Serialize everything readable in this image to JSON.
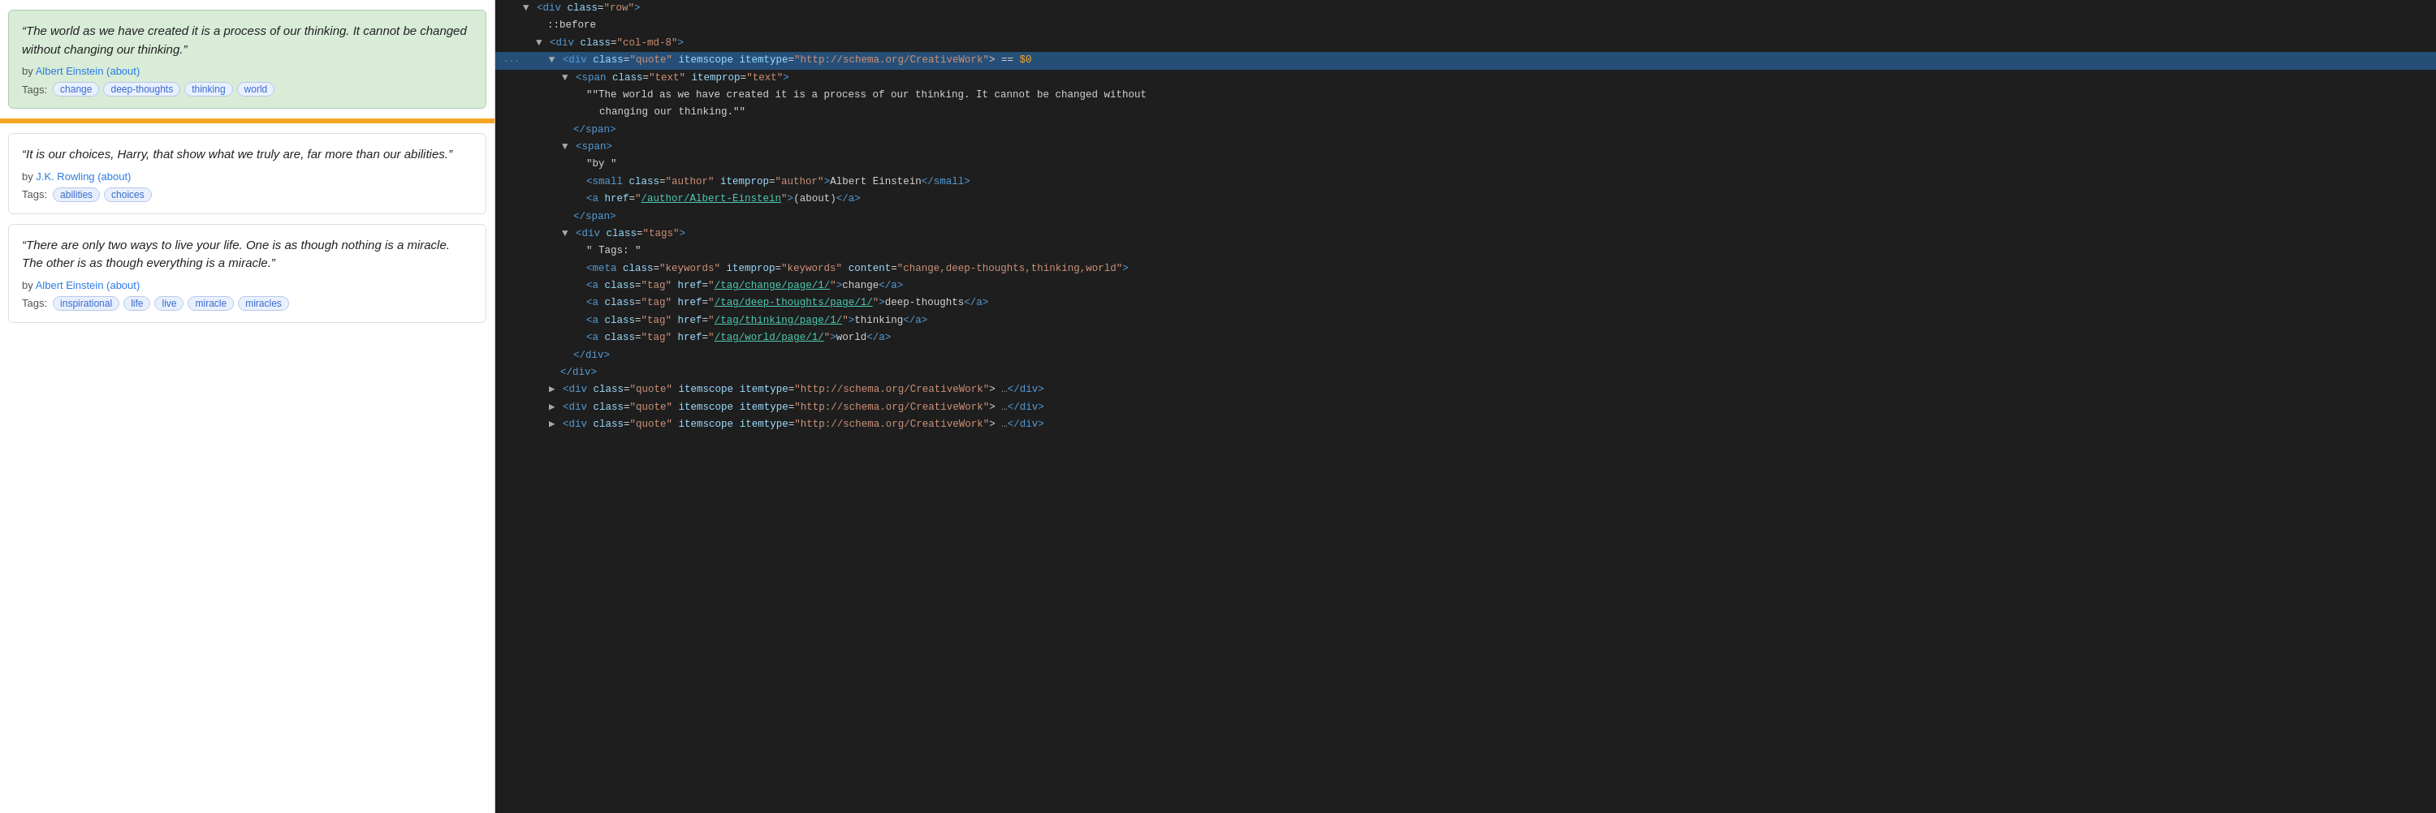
{
  "leftPanel": {
    "quotes": [
      {
        "id": "q1",
        "highlighted": true,
        "text": "“The world as we have created it is a process of our thinking. It cannot be changed without changing our thinking.”",
        "authorName": "Albert Einstein",
        "authorLink": "/author/Albert-Einstein",
        "aboutLink": "/author/Albert-Einstein/about",
        "tags": [
          "change",
          "deep-thoughts",
          "thinking",
          "world"
        ]
      },
      {
        "id": "q2",
        "highlighted": false,
        "text": "“It is our choices, Harry, that show what we truly are, far more than our abilities.”",
        "authorName": "J.K. Rowling",
        "authorLink": "/author/J-K-Rowling",
        "aboutLink": "/author/J-K-Rowling/about",
        "tags": [
          "abilities",
          "choices"
        ]
      },
      {
        "id": "q3",
        "highlighted": false,
        "text": "“There are only two ways to live your life. One is as though nothing is a miracle. The other is as though everything is a miracle.”",
        "authorName": "Albert Einstein",
        "authorLink": "/author/Albert-Einstein",
        "aboutLink": "/author/Albert-Einstein/about",
        "tags": [
          "inspirational",
          "life",
          "live",
          "miracle",
          "miracles"
        ]
      }
    ]
  },
  "rightPanel": {
    "lines": [
      {
        "indent": 0,
        "triangle": "down",
        "content": [
          {
            "t": "c-tag",
            "v": "<div "
          },
          {
            "t": "c-attr",
            "v": "class"
          },
          {
            "t": "c-equals",
            "v": "="
          },
          {
            "t": "c-string",
            "v": "\"row\""
          },
          {
            "t": "c-tag",
            "v": ">"
          }
        ]
      },
      {
        "indent": 1,
        "triangle": null,
        "content": [
          {
            "t": "c-text",
            "v": "::before"
          }
        ]
      },
      {
        "indent": 1,
        "triangle": "down",
        "content": [
          {
            "t": "c-tag",
            "v": "<div "
          },
          {
            "t": "c-attr",
            "v": "class"
          },
          {
            "t": "c-equals",
            "v": "="
          },
          {
            "t": "c-string",
            "v": "\"col-md-8\""
          },
          {
            "t": "c-tag",
            "v": ">"
          }
        ]
      },
      {
        "indent": 2,
        "triangle": "down",
        "content": [
          {
            "t": "c-tag",
            "v": "<div "
          },
          {
            "t": "c-attr",
            "v": "class"
          },
          {
            "t": "c-equals",
            "v": "="
          },
          {
            "t": "c-string",
            "v": "\"quote\""
          },
          {
            "t": "c-text",
            "v": " "
          },
          {
            "t": "c-attr",
            "v": "itemscope"
          },
          {
            "t": "c-text",
            "v": " "
          },
          {
            "t": "c-attr",
            "v": "itemtype"
          },
          {
            "t": "c-equals",
            "v": "="
          },
          {
            "t": "c-string",
            "v": "\"http://schema.org/CreativeWork\""
          },
          {
            "t": "c-text",
            "v": "> == "
          },
          {
            "t": "c-orange",
            "v": "$0"
          }
        ],
        "selected": true,
        "hasDots": true
      },
      {
        "indent": 3,
        "triangle": "down",
        "content": [
          {
            "t": "c-tag",
            "v": "<span "
          },
          {
            "t": "c-attr",
            "v": "class"
          },
          {
            "t": "c-equals",
            "v": "="
          },
          {
            "t": "c-string",
            "v": "\"text\""
          },
          {
            "t": "c-text",
            "v": " "
          },
          {
            "t": "c-attr",
            "v": "itemprop"
          },
          {
            "t": "c-equals",
            "v": "="
          },
          {
            "t": "c-string",
            "v": "\"text\""
          },
          {
            "t": "c-tag",
            "v": ">"
          }
        ]
      },
      {
        "indent": 4,
        "triangle": null,
        "content": [
          {
            "t": "c-text",
            "v": "\"\"The world as we have created it is a process of our thinking. It cannot be changed without"
          }
        ]
      },
      {
        "indent": 5,
        "triangle": null,
        "content": [
          {
            "t": "c-text",
            "v": "changing our thinking.\"\""
          }
        ]
      },
      {
        "indent": 3,
        "triangle": null,
        "content": [
          {
            "t": "c-tag",
            "v": "</span>"
          }
        ]
      },
      {
        "indent": 3,
        "triangle": "down",
        "content": [
          {
            "t": "c-tag",
            "v": "<span>"
          }
        ]
      },
      {
        "indent": 4,
        "triangle": null,
        "content": [
          {
            "t": "c-text",
            "v": "\"by \""
          }
        ]
      },
      {
        "indent": 4,
        "triangle": null,
        "content": [
          {
            "t": "c-tag",
            "v": "<small "
          },
          {
            "t": "c-attr",
            "v": "class"
          },
          {
            "t": "c-equals",
            "v": "="
          },
          {
            "t": "c-string",
            "v": "\"author\""
          },
          {
            "t": "c-text",
            "v": " "
          },
          {
            "t": "c-attr",
            "v": "itemprop"
          },
          {
            "t": "c-equals",
            "v": "="
          },
          {
            "t": "c-string",
            "v": "\"author\""
          },
          {
            "t": "c-tag",
            "v": ">"
          },
          {
            "t": "c-text",
            "v": "Albert Einstein"
          },
          {
            "t": "c-tag",
            "v": "</small>"
          }
        ]
      },
      {
        "indent": 4,
        "triangle": null,
        "content": [
          {
            "t": "c-tag",
            "v": "<a "
          },
          {
            "t": "c-attr",
            "v": "href"
          },
          {
            "t": "c-equals",
            "v": "="
          },
          {
            "t": "c-string",
            "v": "\""
          },
          {
            "t": "c-link",
            "v": "/author/Albert-Einstein"
          },
          {
            "t": "c-string",
            "v": "\""
          },
          {
            "t": "c-tag",
            "v": ">"
          },
          {
            "t": "c-text",
            "v": "(about)"
          },
          {
            "t": "c-tag",
            "v": "</a>"
          }
        ]
      },
      {
        "indent": 3,
        "triangle": null,
        "content": [
          {
            "t": "c-tag",
            "v": "</span>"
          }
        ]
      },
      {
        "indent": 3,
        "triangle": "down",
        "content": [
          {
            "t": "c-tag",
            "v": "<div "
          },
          {
            "t": "c-attr",
            "v": "class"
          },
          {
            "t": "c-equals",
            "v": "="
          },
          {
            "t": "c-string",
            "v": "\"tags\""
          },
          {
            "t": "c-tag",
            "v": ">"
          }
        ]
      },
      {
        "indent": 4,
        "triangle": null,
        "content": [
          {
            "t": "c-text",
            "v": "\" Tags: \""
          }
        ]
      },
      {
        "indent": 4,
        "triangle": null,
        "content": [
          {
            "t": "c-tag",
            "v": "<meta "
          },
          {
            "t": "c-attr",
            "v": "class"
          },
          {
            "t": "c-equals",
            "v": "="
          },
          {
            "t": "c-string",
            "v": "\"keywords\""
          },
          {
            "t": "c-text",
            "v": " "
          },
          {
            "t": "c-attr",
            "v": "itemprop"
          },
          {
            "t": "c-equals",
            "v": "="
          },
          {
            "t": "c-string",
            "v": "\"keywords\""
          },
          {
            "t": "c-text",
            "v": " "
          },
          {
            "t": "c-attr",
            "v": "content"
          },
          {
            "t": "c-equals",
            "v": "="
          },
          {
            "t": "c-string",
            "v": "\"change,deep-thoughts,thinking,world\""
          },
          {
            "t": "c-tag",
            "v": ">"
          }
        ]
      },
      {
        "indent": 4,
        "triangle": null,
        "content": [
          {
            "t": "c-tag",
            "v": "<a "
          },
          {
            "t": "c-attr",
            "v": "class"
          },
          {
            "t": "c-equals",
            "v": "="
          },
          {
            "t": "c-string",
            "v": "\"tag\""
          },
          {
            "t": "c-text",
            "v": " "
          },
          {
            "t": "c-attr",
            "v": "href"
          },
          {
            "t": "c-equals",
            "v": "="
          },
          {
            "t": "c-string",
            "v": "\""
          },
          {
            "t": "c-link",
            "v": "/tag/change/page/1/"
          },
          {
            "t": "c-string",
            "v": "\""
          },
          {
            "t": "c-tag",
            "v": ">"
          },
          {
            "t": "c-text",
            "v": "change"
          },
          {
            "t": "c-tag",
            "v": "</a>"
          }
        ]
      },
      {
        "indent": 4,
        "triangle": null,
        "content": [
          {
            "t": "c-tag",
            "v": "<a "
          },
          {
            "t": "c-attr",
            "v": "class"
          },
          {
            "t": "c-equals",
            "v": "="
          },
          {
            "t": "c-string",
            "v": "\"tag\""
          },
          {
            "t": "c-text",
            "v": " "
          },
          {
            "t": "c-attr",
            "v": "href"
          },
          {
            "t": "c-equals",
            "v": "="
          },
          {
            "t": "c-string",
            "v": "\""
          },
          {
            "t": "c-link",
            "v": "/tag/deep-thoughts/page/1/"
          },
          {
            "t": "c-string",
            "v": "\""
          },
          {
            "t": "c-tag",
            "v": ">"
          },
          {
            "t": "c-text",
            "v": "deep-thoughts"
          },
          {
            "t": "c-tag",
            "v": "</a>"
          }
        ]
      },
      {
        "indent": 4,
        "triangle": null,
        "content": [
          {
            "t": "c-tag",
            "v": "<a "
          },
          {
            "t": "c-attr",
            "v": "class"
          },
          {
            "t": "c-equals",
            "v": "="
          },
          {
            "t": "c-string",
            "v": "\"tag\""
          },
          {
            "t": "c-text",
            "v": " "
          },
          {
            "t": "c-attr",
            "v": "href"
          },
          {
            "t": "c-equals",
            "v": "="
          },
          {
            "t": "c-string",
            "v": "\""
          },
          {
            "t": "c-link",
            "v": "/tag/thinking/page/1/"
          },
          {
            "t": "c-string",
            "v": "\""
          },
          {
            "t": "c-tag",
            "v": ">"
          },
          {
            "t": "c-text",
            "v": "thinking"
          },
          {
            "t": "c-tag",
            "v": "</a>"
          }
        ]
      },
      {
        "indent": 4,
        "triangle": null,
        "content": [
          {
            "t": "c-tag",
            "v": "<a "
          },
          {
            "t": "c-attr",
            "v": "class"
          },
          {
            "t": "c-equals",
            "v": "="
          },
          {
            "t": "c-string",
            "v": "\"tag\""
          },
          {
            "t": "c-text",
            "v": " "
          },
          {
            "t": "c-attr",
            "v": "href"
          },
          {
            "t": "c-equals",
            "v": "="
          },
          {
            "t": "c-string",
            "v": "\""
          },
          {
            "t": "c-link",
            "v": "/tag/world/page/1/"
          },
          {
            "t": "c-string",
            "v": "\""
          },
          {
            "t": "c-tag",
            "v": ">"
          },
          {
            "t": "c-text",
            "v": "world"
          },
          {
            "t": "c-tag",
            "v": "</a>"
          }
        ]
      },
      {
        "indent": 3,
        "triangle": null,
        "content": [
          {
            "t": "c-tag",
            "v": "</div>"
          }
        ]
      },
      {
        "indent": 2,
        "triangle": null,
        "content": [
          {
            "t": "c-tag",
            "v": "</div>"
          }
        ]
      },
      {
        "indent": 2,
        "triangle": "right",
        "content": [
          {
            "t": "c-tag",
            "v": "<div "
          },
          {
            "t": "c-attr",
            "v": "class"
          },
          {
            "t": "c-equals",
            "v": "="
          },
          {
            "t": "c-string",
            "v": "\"quote\""
          },
          {
            "t": "c-text",
            "v": " "
          },
          {
            "t": "c-attr",
            "v": "itemscope"
          },
          {
            "t": "c-text",
            "v": " "
          },
          {
            "t": "c-attr",
            "v": "itemtype"
          },
          {
            "t": "c-equals",
            "v": "="
          },
          {
            "t": "c-string",
            "v": "\"http://schema.org/CreativeWork\""
          },
          {
            "t": "c-text",
            "v": "> "
          },
          {
            "t": "c-comment",
            "v": "…"
          },
          {
            "t": "c-tag",
            "v": "</div>"
          }
        ]
      },
      {
        "indent": 2,
        "triangle": "right",
        "content": [
          {
            "t": "c-tag",
            "v": "<div "
          },
          {
            "t": "c-attr",
            "v": "class"
          },
          {
            "t": "c-equals",
            "v": "="
          },
          {
            "t": "c-string",
            "v": "\"quote\""
          },
          {
            "t": "c-text",
            "v": " "
          },
          {
            "t": "c-attr",
            "v": "itemscope"
          },
          {
            "t": "c-text",
            "v": " "
          },
          {
            "t": "c-attr",
            "v": "itemtype"
          },
          {
            "t": "c-equals",
            "v": "="
          },
          {
            "t": "c-string",
            "v": "\"http://schema.org/CreativeWork\""
          },
          {
            "t": "c-text",
            "v": "> "
          },
          {
            "t": "c-comment",
            "v": "…"
          },
          {
            "t": "c-tag",
            "v": "</div>"
          }
        ]
      },
      {
        "indent": 2,
        "triangle": "right",
        "content": [
          {
            "t": "c-tag",
            "v": "<div "
          },
          {
            "t": "c-attr",
            "v": "class"
          },
          {
            "t": "c-equals",
            "v": "="
          },
          {
            "t": "c-string",
            "v": "\"quote\""
          },
          {
            "t": "c-text",
            "v": " "
          },
          {
            "t": "c-attr",
            "v": "itemscope"
          },
          {
            "t": "c-text",
            "v": " "
          },
          {
            "t": "c-attr",
            "v": "itemtype"
          },
          {
            "t": "c-equals",
            "v": "="
          },
          {
            "t": "c-string",
            "v": "\"http://schema.org/CreativeWork\""
          },
          {
            "t": "c-text",
            "v": "> "
          },
          {
            "t": "c-comment",
            "v": "…"
          },
          {
            "t": "c-tag",
            "v": "</div>"
          }
        ]
      }
    ]
  }
}
